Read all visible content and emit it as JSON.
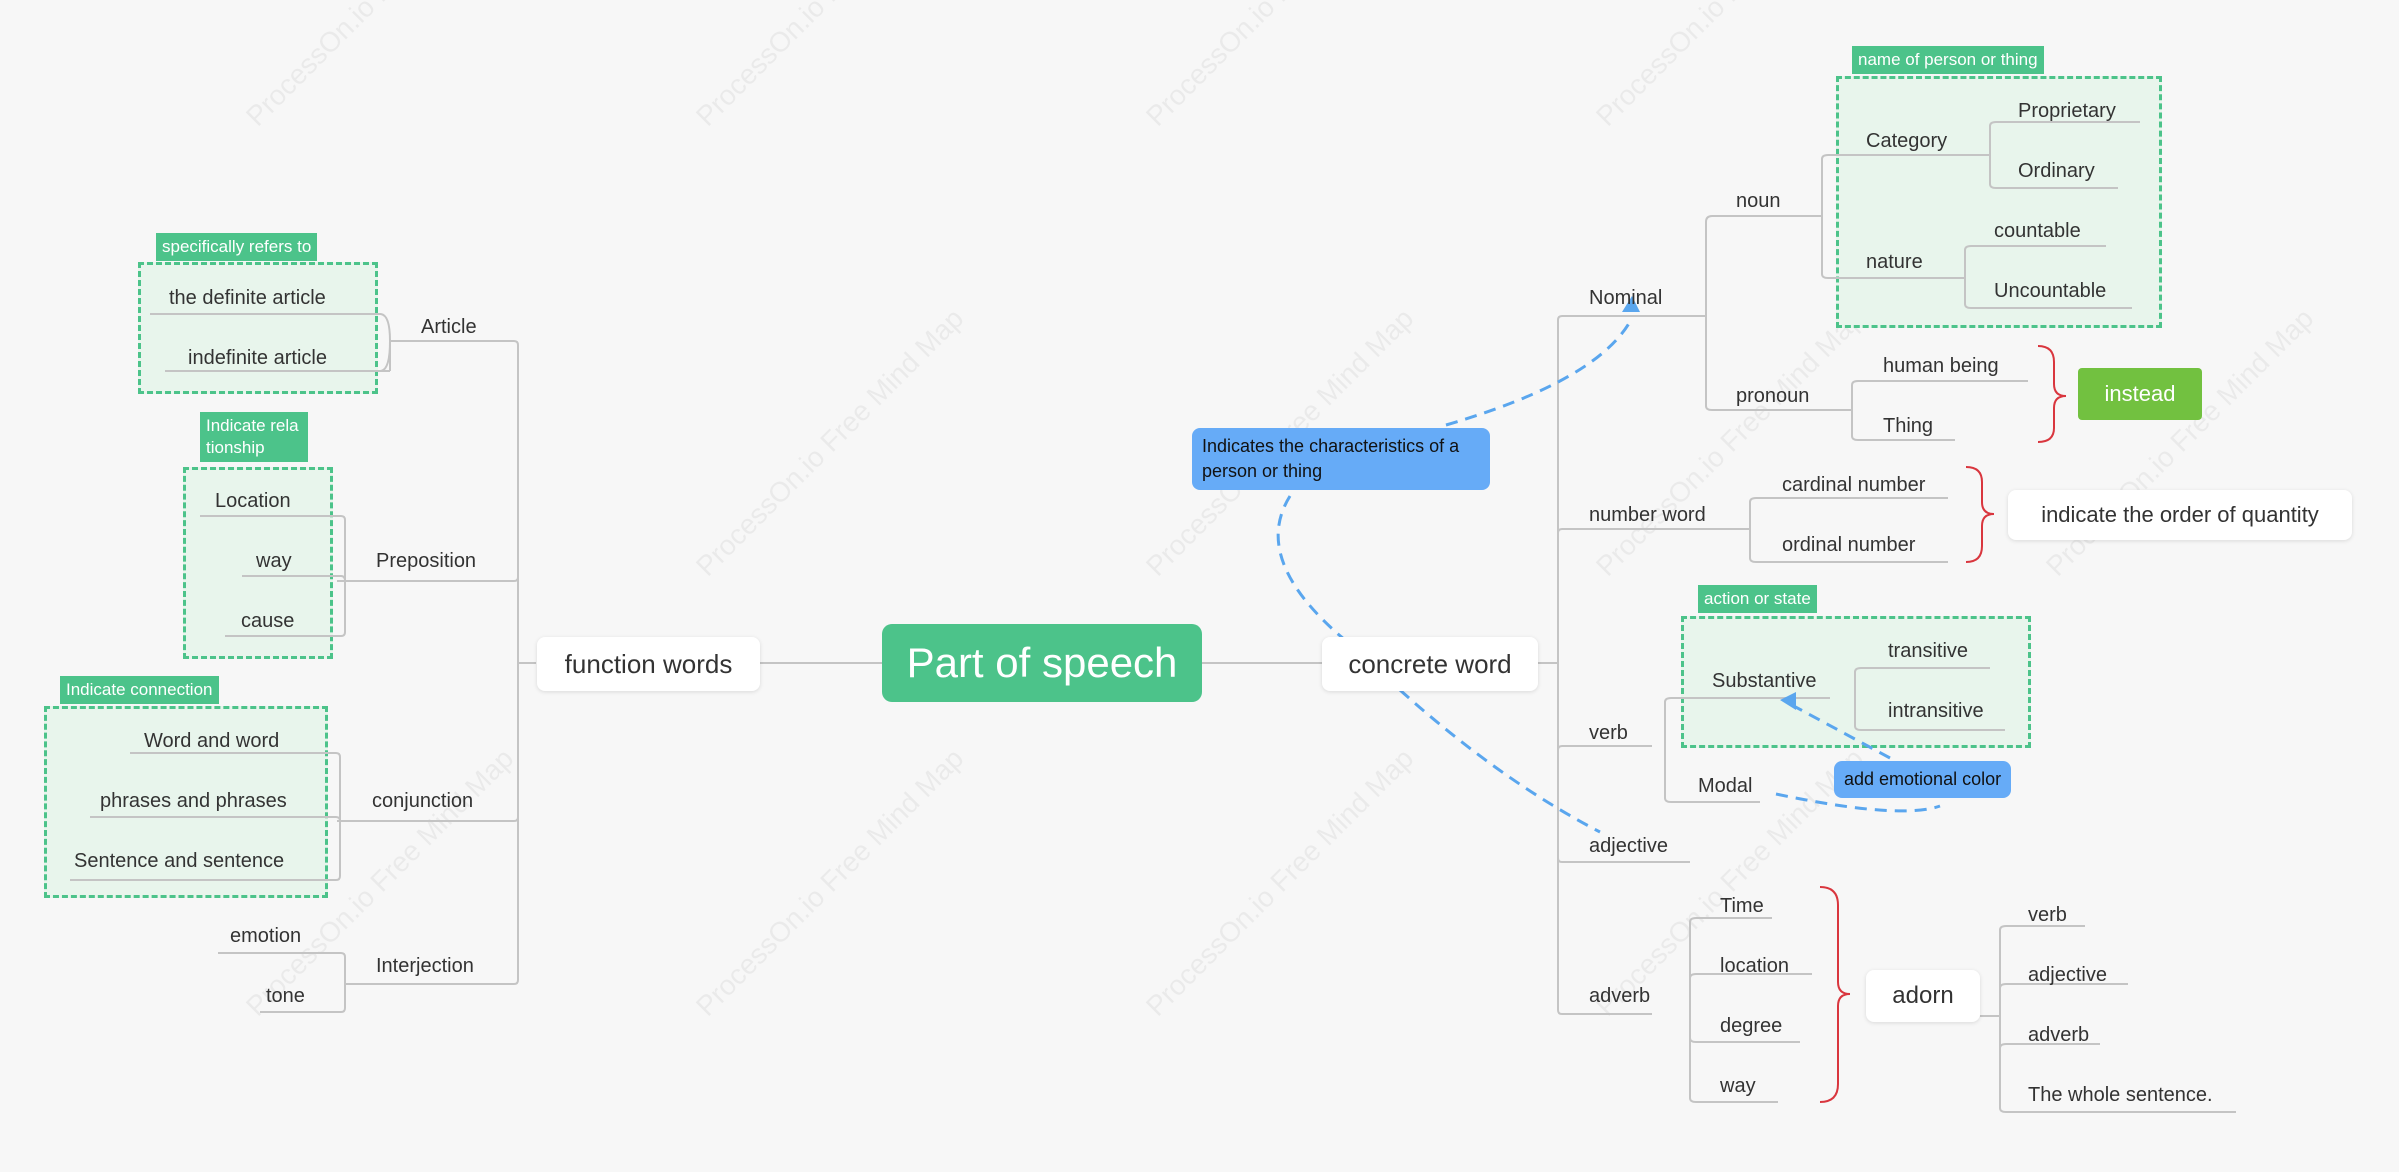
{
  "watermark": {
    "text": "ProcessOn.io Free Mind Map"
  },
  "root": {
    "label": "Part of speech"
  },
  "left": {
    "main": "function words",
    "article": {
      "label": "Article",
      "tag": "specifically refers to",
      "items": [
        "the definite article",
        "indefinite article"
      ]
    },
    "preposition": {
      "label": "Preposition",
      "tag": "Indicate rela tionship",
      "items": [
        "Location",
        "way",
        "cause"
      ]
    },
    "conjunction": {
      "label": "conjunction",
      "tag": "Indicate connection",
      "items": [
        "Word and word",
        "phrases and phrases",
        "Sentence and sentence"
      ]
    },
    "interjection": {
      "label": "Interjection",
      "items": [
        "emotion",
        "tone"
      ]
    }
  },
  "right": {
    "main": "concrete word",
    "callout_characteristics": "Indicates the characteristics of a person or thing",
    "nominal": {
      "label": "Nominal",
      "noun": {
        "label": "noun",
        "tag": "name of person or thing",
        "category": {
          "label": "Category",
          "items": [
            "Proprietary",
            "Ordinary"
          ]
        },
        "nature": {
          "label": "nature",
          "items": [
            "countable",
            "Uncountable"
          ]
        }
      },
      "pronoun": {
        "label": "pronoun",
        "items": [
          "human being",
          "Thing"
        ],
        "summary": "instead"
      }
    },
    "number_word": {
      "label": "number word",
      "items": [
        "cardinal number",
        "ordinal number"
      ],
      "summary": "indicate the order of quantity"
    },
    "verb": {
      "label": "verb",
      "tag": "action or state",
      "substantive": {
        "label": "Substantive",
        "items": [
          "transitive",
          "intransitive"
        ]
      },
      "modal": "Modal",
      "callout": "add emotional color"
    },
    "adjective": "adjective",
    "adverb": {
      "label": "adverb",
      "items": [
        "Time",
        "location",
        "degree",
        "way"
      ],
      "summary": "adorn",
      "targets": [
        "verb",
        "adjective",
        "adverb",
        "The whole sentence."
      ]
    }
  },
  "colors": {
    "accent_green": "#4cc38a",
    "callout_blue": "#66abf7",
    "instead_green": "#72c140",
    "brace_red": "#d9363e",
    "line_gray": "#c4c4c4"
  }
}
